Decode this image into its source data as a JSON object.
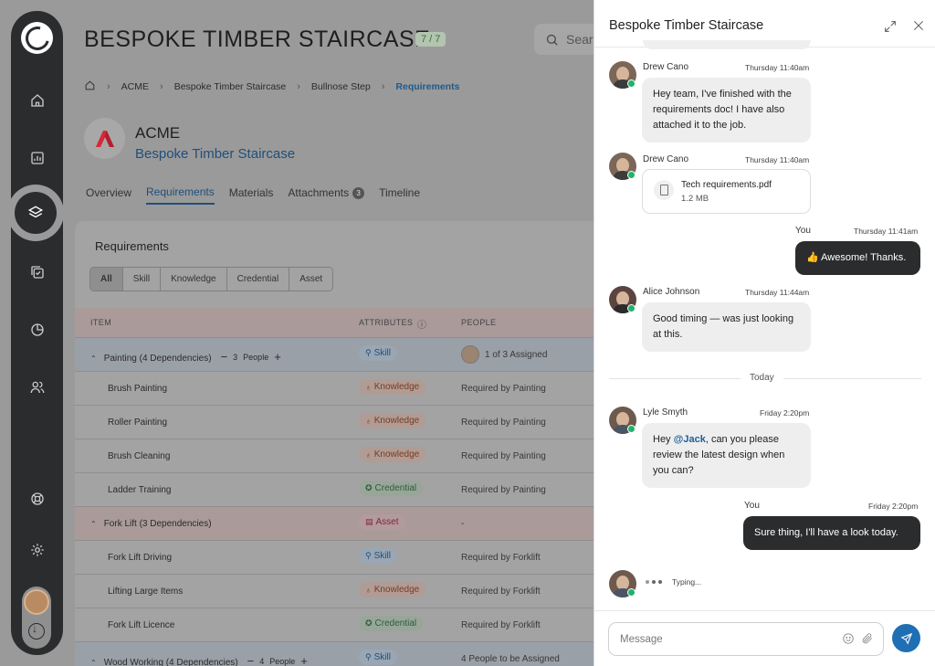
{
  "page": {
    "title": "BESPOKE TIMBER STAIRCASE",
    "count_badge": "7 / 7",
    "search_placeholder": "Sear"
  },
  "breadcrumb": [
    "ACME",
    "Bespoke Timber Staircase",
    "Bullnose Step",
    "Requirements"
  ],
  "company": {
    "name": "ACME",
    "job": "Bespoke Timber Staircase",
    "brand_color": "#c8102e"
  },
  "tabs": [
    {
      "label": "Overview"
    },
    {
      "label": "Requirements",
      "active": true
    },
    {
      "label": "Materials"
    },
    {
      "label": "Attachments",
      "count": "3"
    },
    {
      "label": "Timeline"
    }
  ],
  "requirements": {
    "title": "Requirements",
    "filters": [
      "All",
      "Skill",
      "Knowledge",
      "Credential",
      "Asset"
    ],
    "columns": {
      "item": "ITEM",
      "attributes": "ATTRIBUTES",
      "people": "PEOPLE"
    },
    "rows": [
      {
        "item": "Painting (4 Dependencies)",
        "group": true,
        "stepper": "3",
        "stepper_label": "People",
        "tag": "Skill",
        "tag_type": "skill",
        "people": "1 of 3 Assigned"
      },
      {
        "item": "Brush Painting",
        "tag": "Knowledge",
        "tag_type": "knowledge",
        "people": "Required by Painting"
      },
      {
        "item": "Roller Painting",
        "tag": "Knowledge",
        "tag_type": "knowledge",
        "people": "Required by Painting"
      },
      {
        "item": "Brush Cleaning",
        "tag": "Knowledge",
        "tag_type": "knowledge",
        "people": "Required by Painting"
      },
      {
        "item": "Ladder Training",
        "tag": "Credential",
        "tag_type": "credential",
        "people": "Required by Painting"
      },
      {
        "item": "Fork Lift (3 Dependencies)",
        "group": true,
        "pink": true,
        "tag": "Asset",
        "tag_type": "asset",
        "people": "-"
      },
      {
        "item": "Fork Lift Driving",
        "tag": "Skill",
        "tag_type": "skill",
        "people": "Required by Forklift"
      },
      {
        "item": "Lifting Large Items",
        "tag": "Knowledge",
        "tag_type": "knowledge",
        "people": "Required by Forklift"
      },
      {
        "item": "Fork Lift Licence",
        "tag": "Credential",
        "tag_type": "credential",
        "people": "Required by Forklift"
      },
      {
        "item": "Wood Working (4 Dependencies)",
        "group": true,
        "stepper": "4",
        "stepper_label": "People",
        "tag": "Skill",
        "tag_type": "skill",
        "people": "4 People to be Assigned"
      }
    ]
  },
  "chat": {
    "title": "Bespoke Timber Staircase",
    "messages": [
      {
        "sender": "Drew Cano",
        "time": "Thursday 11:40am",
        "text": "Hey team, I've finished with the requirements doc! I have also attached it to the job."
      },
      {
        "sender": "Drew Cano",
        "time": "Thursday 11:40am",
        "file_name": "Tech requirements.pdf",
        "file_size": "1.2 MB"
      },
      {
        "sender": "You",
        "time": "Thursday 11:41am",
        "text": "👍 Awesome! Thanks."
      },
      {
        "sender": "Alice Johnson",
        "time": "Thursday 11:44am",
        "text": "Good timing — was just looking at this."
      },
      {
        "sender": "Lyle Smyth",
        "time": "Friday 2:20pm",
        "text_before": "Hey ",
        "mention": "@Jack",
        "text_after": ", can you please review the latest design when you can?"
      },
      {
        "sender": "You",
        "time": "Friday 2:20pm",
        "text": "Sure thing, I'll have a look today."
      }
    ],
    "divider": "Today",
    "typing": "Typing...",
    "input_placeholder": "Message",
    "accent": "#1f6fb5",
    "online_color": "#21b36b"
  }
}
